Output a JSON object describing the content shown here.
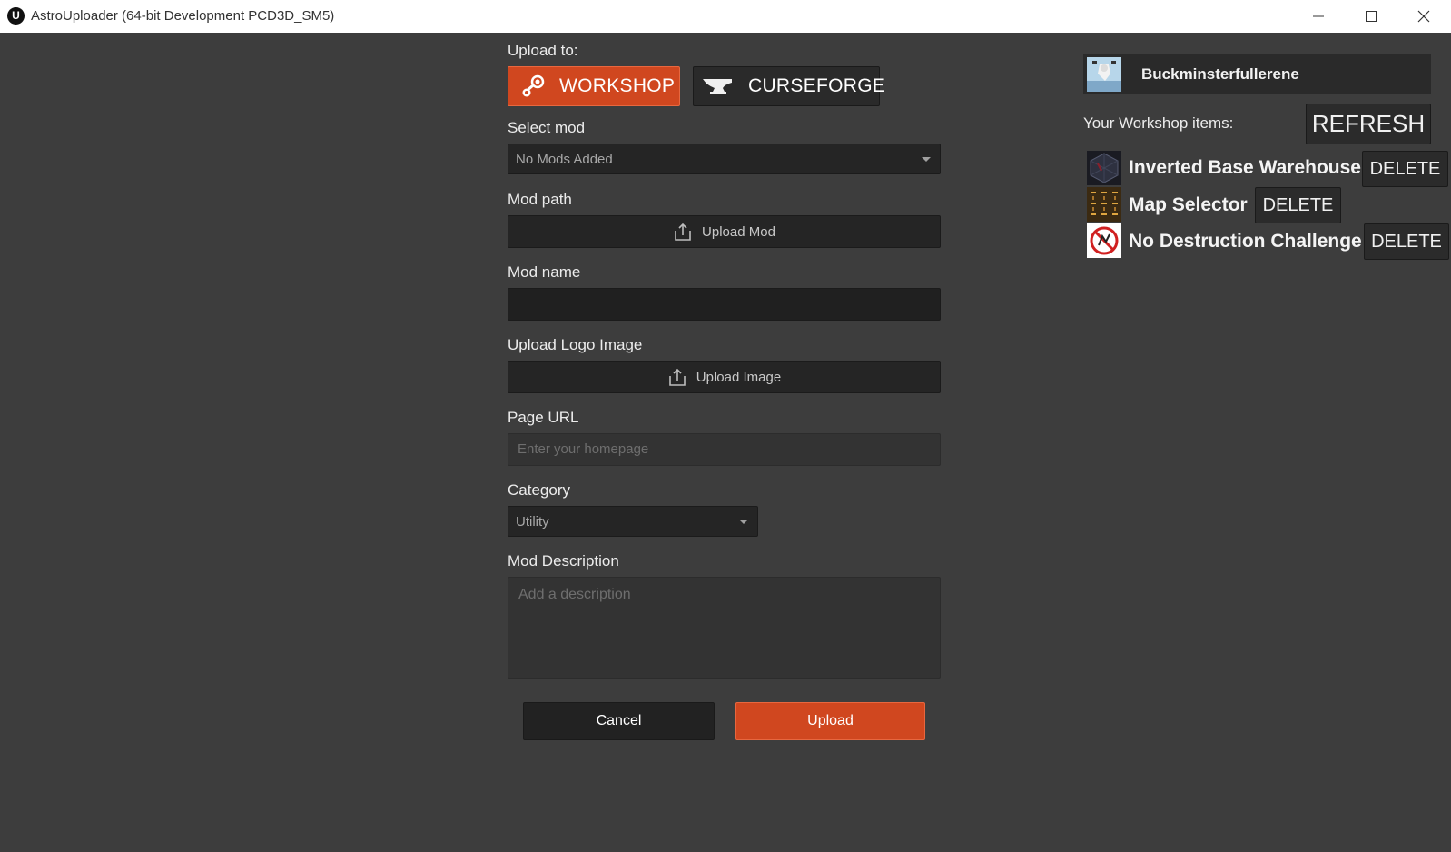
{
  "window": {
    "title": "AstroUploader (64-bit Development PCD3D_SM5)",
    "logo_letter": "U"
  },
  "form": {
    "upload_to_label": "Upload to:",
    "targets": [
      {
        "label": "WORKSHOP",
        "icon": "steam-icon",
        "selected": true
      },
      {
        "label": "CURSEFORGE",
        "icon": "anvil-icon",
        "selected": false
      }
    ],
    "select_mod_label": "Select mod",
    "select_mod_value": "No Mods Added",
    "mod_path_label": "Mod path",
    "upload_mod_label": "Upload Mod",
    "mod_name_label": "Mod name",
    "mod_name_value": "",
    "logo_label": "Upload Logo Image",
    "upload_image_label": "Upload Image",
    "page_url_label": "Page URL",
    "page_url_placeholder": "Enter your homepage",
    "category_label": "Category",
    "category_value": "Utility",
    "description_label": "Mod Description",
    "description_placeholder": "Add a description",
    "cancel_label": "Cancel",
    "upload_label": "Upload"
  },
  "sidebar": {
    "user_name": "Buckminsterfullerene",
    "items_label": "Your Workshop items:",
    "refresh_label": "REFRESH",
    "items": [
      {
        "name": "Inverted Base Warehouse",
        "delete_label": "DELETE"
      },
      {
        "name": "Map Selector",
        "delete_label": "DELETE"
      },
      {
        "name": "No Destruction Challenge",
        "delete_label": "DELETE"
      }
    ]
  },
  "colors": {
    "accent": "#d0471f",
    "background": "#3d3d3d",
    "field": "#252525"
  }
}
